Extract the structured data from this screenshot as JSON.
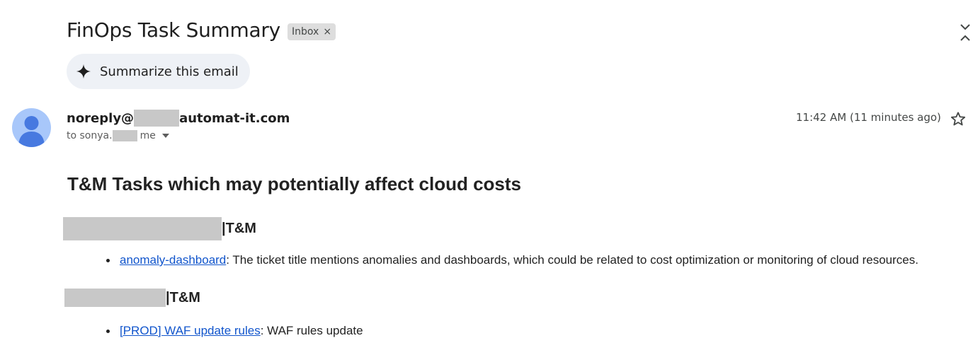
{
  "email": {
    "subject": "FinOps Task Summary",
    "label_chip": {
      "label": "Inbox",
      "remove_symbol": "×"
    },
    "summarize_button": {
      "label": "Summarize this email",
      "icon": "sparkle-icon"
    },
    "sender": {
      "prefix": "noreply@",
      "domain": "automat-it.com"
    },
    "recipients": {
      "to_prefix": "to sonya.",
      "me": "me"
    },
    "timestamp": "11:42 AM (11 minutes ago)",
    "icons": {
      "collapse": "collapse-all-icon",
      "star": "star-icon",
      "avatar": "default-avatar-icon",
      "dropdown": "caret-down-icon"
    }
  },
  "body": {
    "title": "T&M Tasks which may potentially affect cloud costs",
    "sections": [
      {
        "heading_suffix": "|T&M",
        "items": [
          {
            "link": "anomaly-dashboard",
            "text": ": The ticket title mentions anomalies and dashboards, which could be related to cost optimization or monitoring of cloud resources."
          }
        ]
      },
      {
        "heading_suffix": "|T&M",
        "items": [
          {
            "link": "[PROD] WAF update rules",
            "text": ": WAF rules update"
          }
        ]
      }
    ]
  },
  "colors": {
    "link": "#1155cc",
    "redaction": "#c8c8c8",
    "summarize_bg": "#eef1f6",
    "avatar_bg": "#a8c7fa",
    "avatar_fg": "#4779e0"
  }
}
